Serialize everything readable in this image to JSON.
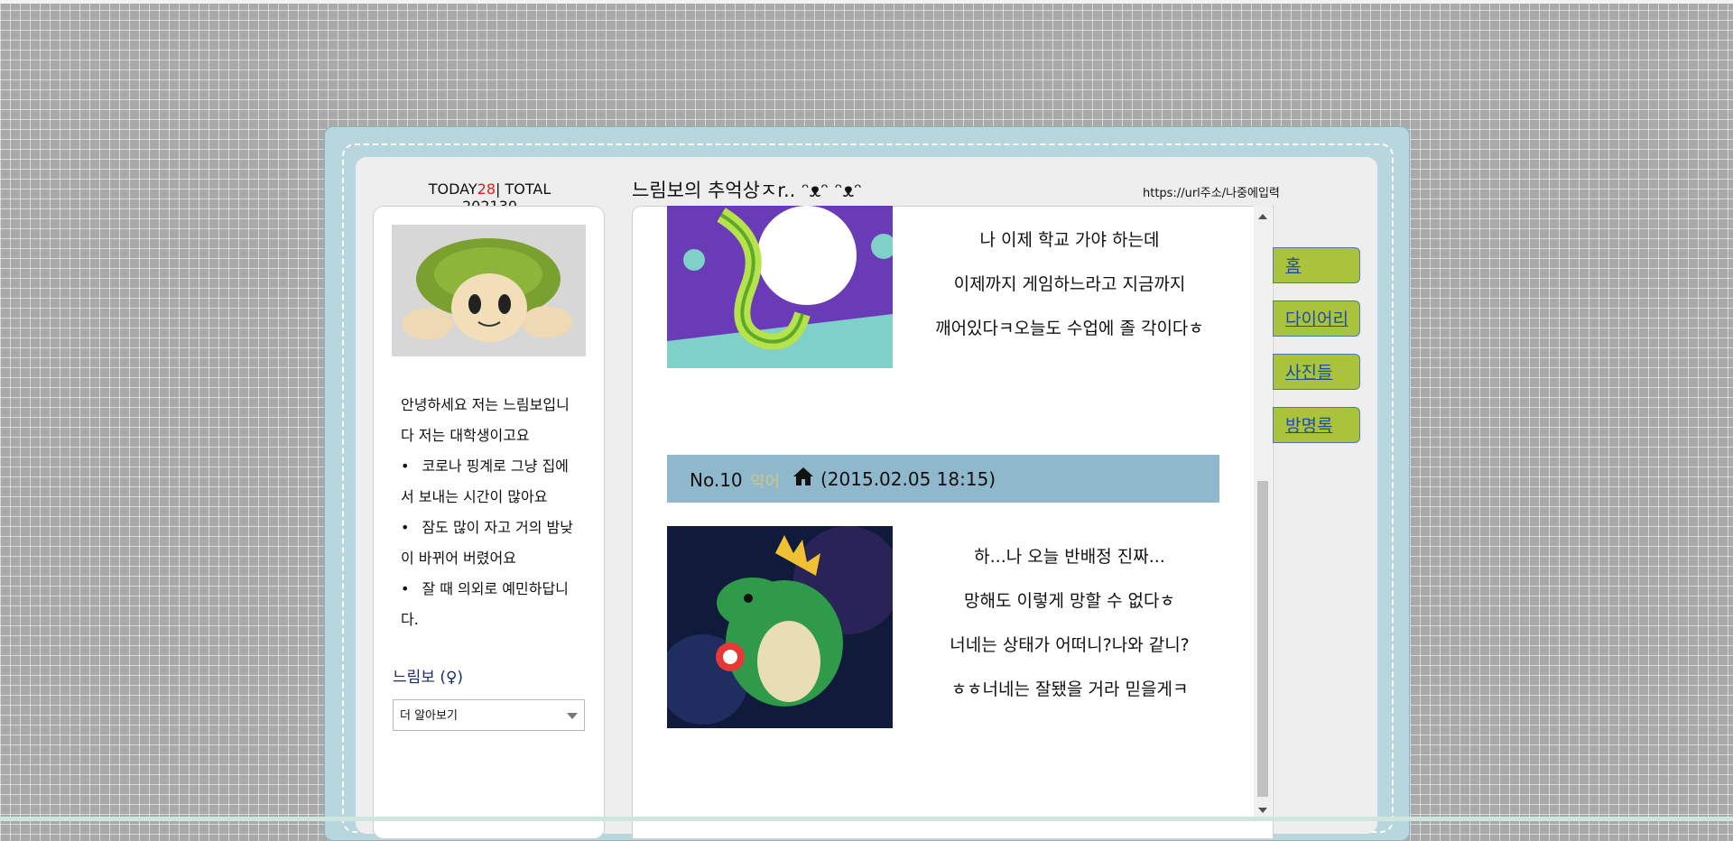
{
  "header": {
    "today_label": "TODAY",
    "today_count": "28",
    "total_text": "| TOTAL 202130",
    "title": "느림보의 추억상ㅈr.. ᵔᴥᵔ ᵔᴥᵔ",
    "url_text": "https://url주소/나중에입력"
  },
  "sidebar": {
    "intro_first": "안녕하세요 저는 느림보입니다 저는 대학생이고요",
    "bullets": [
      "코로나 핑계로 그냥 집에서 보내는 시간이 많아요",
      "잠도 많이 자고 거의 밤낮이 바뀌어 버렸어요",
      "잘 때 의외로 예민하답니다."
    ],
    "profile_name": "느림보 (♀)",
    "select_value": "더 알아보기"
  },
  "posts": [
    {
      "lines": [
        "나 이제 학교 가야 하는데",
        "이제까지 게임하느라고 지금까지",
        "깨어있다ㅋ오늘도 수업에 졸 각이다ㅎ"
      ]
    },
    {
      "number": "No.10",
      "muted": "약어",
      "date": "(2015.02.05 18:15)",
      "lines": [
        "하...나 오늘 반배정 진짜...",
        "망해도 이렇게 망할 수 없다ㅎ",
        "너네는 상태가 어떠니?나와 같니?",
        "ㅎㅎ너네는 잘됐을 거라 믿을게ㅋ"
      ]
    }
  ],
  "menu": [
    "홈",
    "다이어리",
    "사진들",
    "방명록"
  ],
  "icons": [
    "home-icon",
    "chevron-down-icon",
    "scroll-up-icon",
    "scroll-down-icon"
  ]
}
